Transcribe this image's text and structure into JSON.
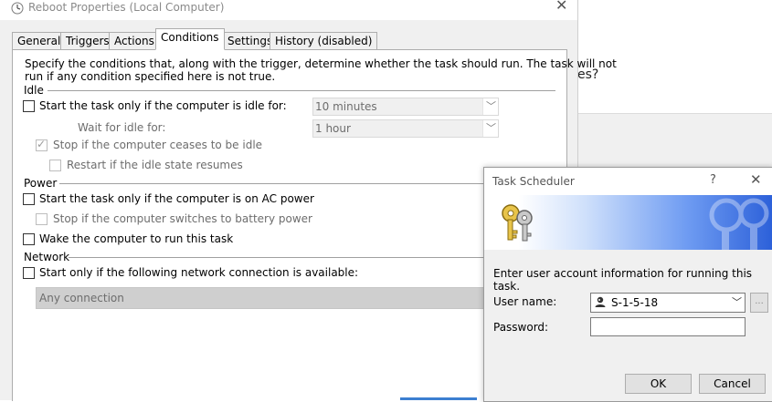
{
  "background": {
    "fragment_text": "es?"
  },
  "window": {
    "title": "Reboot Properties (Local Computer)",
    "tabs": [
      {
        "label": "General"
      },
      {
        "label": "Triggers"
      },
      {
        "label": "Actions"
      },
      {
        "label": "Conditions",
        "active": true
      },
      {
        "label": "Settings"
      },
      {
        "label": "History (disabled)"
      }
    ],
    "intro_line1": "Specify the conditions that, along with the trigger, determine whether the task should run.  The task will not",
    "intro_line2": "run  if any condition specified here is not true.",
    "idle": {
      "section_label": "Idle",
      "start_only_idle_label": "Start the task only if the computer is idle for:",
      "start_only_idle_checked": false,
      "idle_for_value": "10 minutes",
      "wait_label": "Wait for idle for:",
      "wait_value": "1 hour",
      "stop_if_ceases_label": "Stop if the computer ceases to be idle",
      "stop_if_ceases_checked": true,
      "restart_label": "Restart if the idle state resumes",
      "restart_checked": false
    },
    "power": {
      "section_label": "Power",
      "ac_power_label": "Start the task only if the computer is on AC power",
      "ac_power_checked": false,
      "battery_label": "Stop if the computer switches to battery power",
      "battery_checked": false,
      "wake_label": "Wake the computer to run this task",
      "wake_checked": false
    },
    "network": {
      "section_label": "Network",
      "connection_label": "Start only if the following network connection is available:",
      "connection_checked": false,
      "connection_value": "Any connection"
    }
  },
  "dialog": {
    "title": "Task Scheduler",
    "help_glyph": "?",
    "close_glyph": "✕",
    "message": "Enter user account information for running this task.",
    "user_name_label": "User name:",
    "user_name_value": "S-1-5-18",
    "browse_label": "...",
    "password_label": "Password:",
    "password_value": "",
    "ok_label": "OK",
    "cancel_label": "Cancel",
    "accent_color": "#2c60d9"
  }
}
